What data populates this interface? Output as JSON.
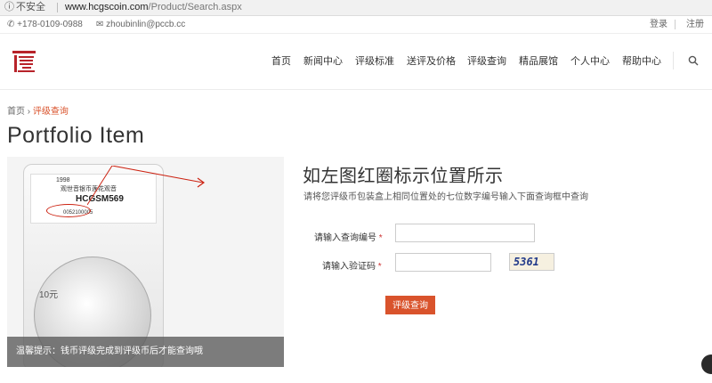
{
  "browser": {
    "security_text": "不安全",
    "url_domain": "www.hcgscoin.com",
    "url_path": "/Product/Search.aspx"
  },
  "topbar": {
    "phone": "+178-0109-0988",
    "email": "zhoubinlin@pccb.cc",
    "login": "登录",
    "register": "注册"
  },
  "nav": {
    "items": [
      "首页",
      "新闻中心",
      "评级标准",
      "送评及价格",
      "评级查询",
      "精品展馆",
      "个人中心",
      "帮助中心"
    ]
  },
  "breadcrumb": {
    "home": "首页",
    "separator": "›",
    "current": "评级查询"
  },
  "page_title": "Portfolio Item",
  "coin_image": {
    "year": "1998",
    "name": "观世音银币莲花观音",
    "code": "HCGSM569",
    "serial": "0052100005",
    "denomination": "10元",
    "tip": "温馨提示：钱币评级完成到评级币后才能查询哦"
  },
  "form": {
    "heading": "如左图红圈标示位置所示",
    "subtext": "请将您评级币包装盒上相同位置处的七位数字编号输入下面查询框中查询",
    "query_label": "请输入查询编号",
    "captcha_label": "请输入验证码",
    "required_mark": "*",
    "captcha_text": "5361",
    "query_value": "",
    "captcha_value": "",
    "submit_label": "评级查询"
  },
  "colors": {
    "accent": "#d9532c",
    "logo_red": "#b8232a"
  }
}
